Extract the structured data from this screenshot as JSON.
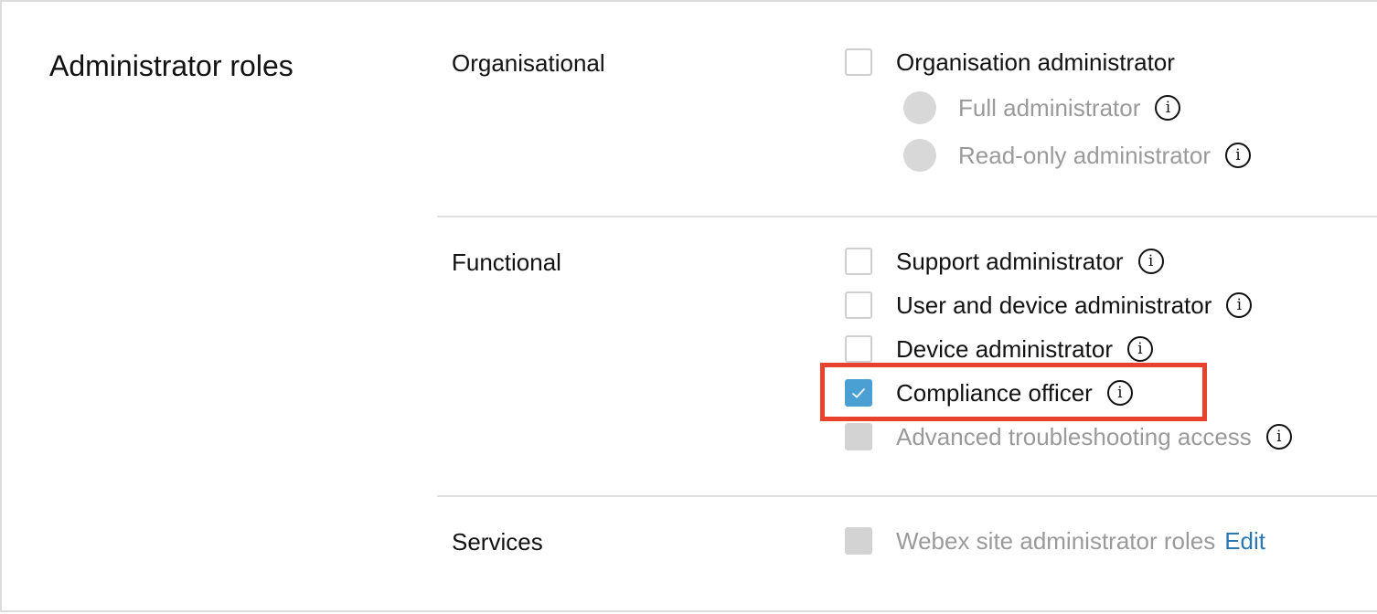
{
  "title": "Administrator roles",
  "sections": {
    "organisational": {
      "label": "Organisational",
      "checkbox_label": "Organisation administrator",
      "checked": false,
      "radios": [
        {
          "label": "Full administrator",
          "enabled": false
        },
        {
          "label": "Read-only administrator",
          "enabled": false
        }
      ]
    },
    "functional": {
      "label": "Functional",
      "items": [
        {
          "label": "Support administrator",
          "checked": false,
          "enabled": true
        },
        {
          "label": "User and device administrator",
          "checked": false,
          "enabled": true
        },
        {
          "label": "Device administrator",
          "checked": false,
          "enabled": true
        },
        {
          "label": "Compliance officer",
          "checked": true,
          "enabled": true
        },
        {
          "label": "Advanced troubleshooting access",
          "checked": false,
          "enabled": false
        }
      ]
    },
    "services": {
      "label": "Services",
      "checkbox_label": "Webex site administrator roles",
      "edit_label": "Edit",
      "enabled": false
    }
  },
  "icons": {
    "info": "info-circle-icon",
    "check": "checkmark-icon"
  },
  "colors": {
    "accent": "#4a9fd3",
    "link": "#2a78b4",
    "highlight": "#e8412e",
    "disabled": "#d3d3d3"
  }
}
